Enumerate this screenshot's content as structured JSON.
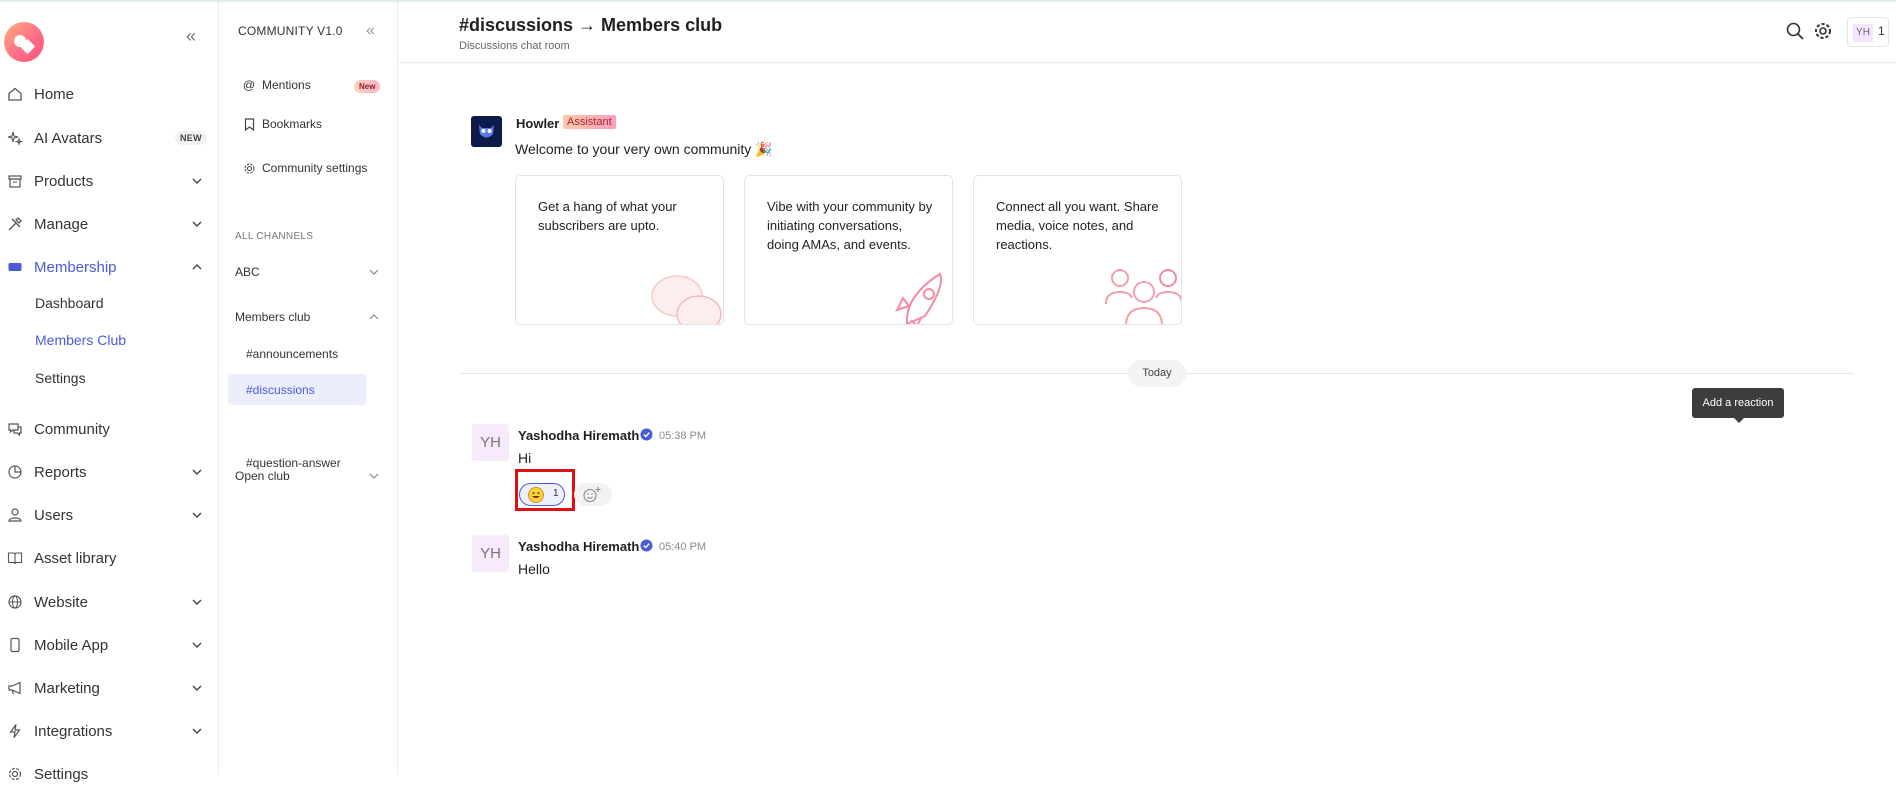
{
  "sidebar": {
    "collapse_icon": "chevrons-left-icon",
    "items": [
      {
        "label": "Home",
        "icon": "home-icon"
      },
      {
        "label": "AI Avatars",
        "icon": "sparkles-icon",
        "badge": "NEW"
      },
      {
        "label": "Products",
        "icon": "box-icon"
      },
      {
        "label": "Manage",
        "icon": "tools-icon"
      },
      {
        "label": "Membership",
        "icon": "membership-card-icon",
        "expanded": true
      },
      {
        "label": "Community",
        "icon": "chat-icon"
      },
      {
        "label": "Reports",
        "icon": "pie-chart-icon"
      },
      {
        "label": "Users",
        "icon": "user-icon"
      },
      {
        "label": "Asset library",
        "icon": "book-icon"
      },
      {
        "label": "Website",
        "icon": "globe-icon"
      },
      {
        "label": "Mobile App",
        "icon": "mobile-icon"
      },
      {
        "label": "Marketing",
        "icon": "megaphone-icon"
      },
      {
        "label": "Integrations",
        "icon": "bolt-icon"
      },
      {
        "label": "Settings",
        "icon": "gear-icon"
      }
    ],
    "membership_sub": [
      "Dashboard",
      "Members Club",
      "Settings"
    ],
    "active_sub": "Members Club",
    "accent_color": "#4a5bd8"
  },
  "community": {
    "title": "COMMUNITY V1.0",
    "mentions": "Mentions",
    "mentions_badge": "New",
    "bookmarks": "Bookmarks",
    "settings": "Community settings",
    "section": "ALL CHANNELS",
    "groups": [
      "ABC",
      "Members club",
      "Open club"
    ],
    "channels": [
      "#announcements",
      "#discussions",
      "#question-answer"
    ],
    "active_channel": "#discussions"
  },
  "header": {
    "title": "#discussions → Members club",
    "subtitle": "Discussions chat room",
    "avatar_initials": "YH",
    "avatar_count": "1"
  },
  "chat": {
    "bot": {
      "name": "Howler",
      "tag": "Assistant",
      "message": "Welcome to your very own community 🎉"
    },
    "cards": [
      "Get a hang of what your subscribers are upto.",
      "Vibe with your community by initiating conversations, doing AMAs, and events.",
      "Connect all you want. Share media, voice notes, and reactions."
    ],
    "day_label": "Today",
    "tooltip": "Add a reaction",
    "messages": [
      {
        "initials": "YH",
        "name": "Yashodha Hiremath",
        "time": "05:38 PM",
        "text": "Hi",
        "reaction_count": "1"
      },
      {
        "initials": "YH",
        "name": "Yashodha Hiremath",
        "time": "05:40 PM",
        "text": "Hello"
      }
    ]
  }
}
